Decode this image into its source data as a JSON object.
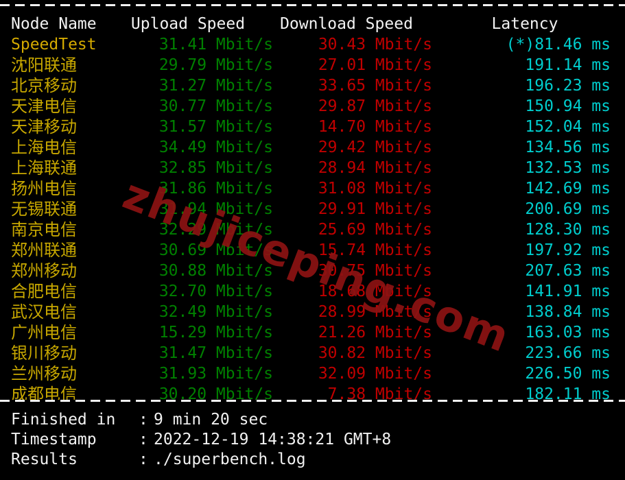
{
  "terminal": {
    "background": "#000000",
    "separator_char": "-",
    "colors": {
      "header": "#f2f2f2",
      "node": "#c8a800",
      "upload": "#008000",
      "download": "#c00000",
      "latency": "#00cdcd",
      "watermark": "#8c1313"
    }
  },
  "watermark": {
    "text": "zhujiceping.com"
  },
  "table": {
    "headers": {
      "node": "Node Name",
      "upload": "Upload Speed",
      "download": "Download Speed",
      "latency": "Latency"
    },
    "rows": [
      {
        "node": "SpeedTest",
        "upload": "31.41 Mbit/s",
        "download": "30.43 Mbit/s",
        "latency": "(*)81.46 ms"
      },
      {
        "node": "沈阳联通",
        "upload": "29.79 Mbit/s",
        "download": "27.01 Mbit/s",
        "latency": "191.14 ms"
      },
      {
        "node": "北京移动",
        "upload": "31.27 Mbit/s",
        "download": "33.65 Mbit/s",
        "latency": "196.23 ms"
      },
      {
        "node": "天津电信",
        "upload": "30.77 Mbit/s",
        "download": "29.87 Mbit/s",
        "latency": "150.94 ms"
      },
      {
        "node": "天津移动",
        "upload": "31.57 Mbit/s",
        "download": "14.70 Mbit/s",
        "latency": "152.04 ms"
      },
      {
        "node": "上海电信",
        "upload": "34.49 Mbit/s",
        "download": "29.42 Mbit/s",
        "latency": "134.56 ms"
      },
      {
        "node": "上海联通",
        "upload": "32.85 Mbit/s",
        "download": "28.94 Mbit/s",
        "latency": "132.53 ms"
      },
      {
        "node": "扬州电信",
        "upload": "31.86 Mbit/s",
        "download": "31.08 Mbit/s",
        "latency": "142.69 ms"
      },
      {
        "node": "无锡联通",
        "upload": "31.94 Mbit/s",
        "download": "29.91 Mbit/s",
        "latency": "200.69 ms"
      },
      {
        "node": "南京电信",
        "upload": "32.29 Mbit/s",
        "download": "25.69 Mbit/s",
        "latency": "128.30 ms"
      },
      {
        "node": "郑州联通",
        "upload": "30.69 Mbit/s",
        "download": "15.74 Mbit/s",
        "latency": "197.92 ms"
      },
      {
        "node": "郑州移动",
        "upload": "30.88 Mbit/s",
        "download": "30.75 Mbit/s",
        "latency": "207.63 ms"
      },
      {
        "node": "合肥电信",
        "upload": "32.70 Mbit/s",
        "download": "18.68 Mbit/s",
        "latency": "141.91 ms"
      },
      {
        "node": "武汉电信",
        "upload": "32.49 Mbit/s",
        "download": "28.99 Mbit/s",
        "latency": "138.84 ms"
      },
      {
        "node": "广州电信",
        "upload": "15.29 Mbit/s",
        "download": "21.26 Mbit/s",
        "latency": "163.03 ms"
      },
      {
        "node": "银川移动",
        "upload": "31.47 Mbit/s",
        "download": "30.82 Mbit/s",
        "latency": "223.66 ms"
      },
      {
        "node": "兰州移动",
        "upload": "31.93 Mbit/s",
        "download": "32.09 Mbit/s",
        "latency": "226.50 ms"
      },
      {
        "node": "成都电信",
        "upload": "30.20 Mbit/s",
        "download": "7.38 Mbit/s",
        "latency": "182.11 ms"
      }
    ]
  },
  "footer": {
    "rows": [
      {
        "label": "Finished in",
        "colon": ":",
        "value": "9 min 20 sec"
      },
      {
        "label": "Timestamp",
        "colon": ":",
        "value": "2022-12-19 14:38:21 GMT+8"
      },
      {
        "label": "Results",
        "colon": ":",
        "value": "./superbench.log"
      }
    ]
  }
}
